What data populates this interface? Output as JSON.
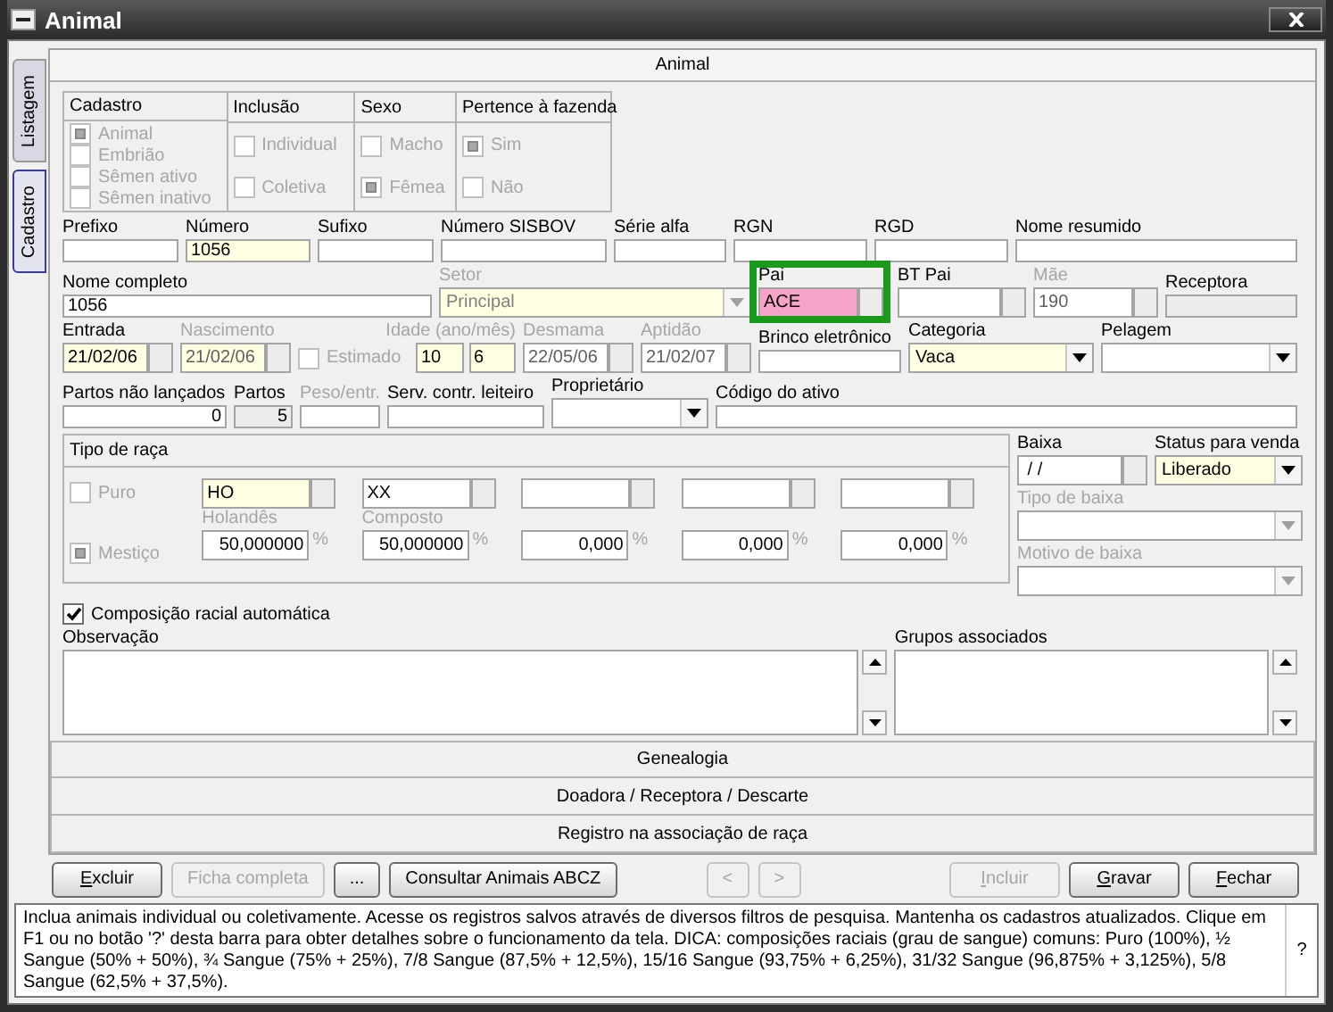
{
  "window": {
    "title": "Animal"
  },
  "side_tabs": [
    {
      "label": "Listagem",
      "selected": false
    },
    {
      "label": "Cadastro",
      "selected": true
    }
  ],
  "panel": {
    "title": "Animal"
  },
  "flags": {
    "disabled": true,
    "columns": [
      {
        "title": "Cadastro",
        "options": [
          {
            "label": "Animal",
            "checked": true
          },
          {
            "label": "Embrião",
            "checked": false
          },
          {
            "label": "Sêmen ativo",
            "checked": false
          },
          {
            "label": "Sêmen inativo",
            "checked": false
          }
        ]
      },
      {
        "title": "Inclusão",
        "options": [
          {
            "label": "Individual",
            "checked": false
          },
          {
            "label": "Coletiva",
            "checked": false
          }
        ]
      },
      {
        "title": "Sexo",
        "options": [
          {
            "label": "Macho",
            "checked": false
          },
          {
            "label": "Fêmea",
            "checked": true
          }
        ]
      },
      {
        "title": "Pertence à fazenda",
        "options": [
          {
            "label": "Sim",
            "checked": true
          },
          {
            "label": "Não",
            "checked": false
          }
        ]
      }
    ]
  },
  "field_rows": [
    [
      {
        "kind": "text",
        "label": "Prefixo",
        "color": "#ffffff",
        "disabled": false
      },
      {
        "kind": "text",
        "label": "Número",
        "value": "1056",
        "color": "#ffffe1",
        "disabled": false
      },
      {
        "kind": "text",
        "label": "Sufixo",
        "color": "#ffffff",
        "disabled": false
      },
      {
        "kind": "text",
        "label": "Número SISBOV",
        "color": "#ffffff",
        "disabled": false
      },
      {
        "kind": "text",
        "label": "Série alfa",
        "color": "#ffffff",
        "disabled": false
      },
      {
        "kind": "text",
        "label": "RGN",
        "color": "#ffffff",
        "disabled": false
      },
      {
        "kind": "text",
        "label": "RGD",
        "color": "#ffffff",
        "disabled": false
      },
      {
        "kind": "text",
        "label": "Nome resumido",
        "color": "#ffffff",
        "disabled": false
      }
    ],
    [
      {
        "kind": "text",
        "label": "Nome completo",
        "value": "1056",
        "color": "#ffffff",
        "disabled": false
      },
      {
        "kind": "dropdown",
        "label": "Setor",
        "value": "Principal",
        "color": "#ffffe1",
        "disabled": true
      },
      {
        "kind": "lookup",
        "label": "Pai",
        "value": "ACE",
        "color": "#f5a3c7",
        "disabled": false,
        "highlighted": true
      },
      {
        "kind": "lookup",
        "label": "BT Pai",
        "color": "#ffffff",
        "disabled": false,
        "highlighted": false
      },
      {
        "kind": "lookup",
        "label": "Mãe",
        "value": "190",
        "color": "#ffffff",
        "disabled": true,
        "highlighted": false
      },
      {
        "kind": "text",
        "label": "Receptora",
        "color": "#ececec",
        "disabled": false
      }
    ],
    [
      {
        "kind": "date",
        "label": "Entrada",
        "value": "21/02/06",
        "color": "#ffffe1",
        "disabled": false
      },
      {
        "kind": "date",
        "label": "Nascimento",
        "value": "21/02/06",
        "color": "#ffffe1",
        "disabled": true
      },
      {
        "kind": "check",
        "label": "Estimado",
        "checked": false,
        "disabled": true
      },
      {
        "kind": "pair",
        "label": "Idade (ano/mês)",
        "values": [
          "10",
          "6"
        ],
        "color": "#ffffe1",
        "disabled": true
      },
      {
        "kind": "date",
        "label": "Desmama",
        "value": "22/05/06",
        "color": "#ffffff",
        "disabled": true
      },
      {
        "kind": "date",
        "label": "Aptidão",
        "value": "21/02/07",
        "color": "#ffffff",
        "disabled": true
      },
      {
        "kind": "text",
        "label": "Brinco eletrônico",
        "color": "#ffffff",
        "disabled": false
      },
      {
        "kind": "dropdown",
        "label": "Categoria",
        "value": "Vaca",
        "color": "#ffffe1",
        "disabled": false
      },
      {
        "kind": "dropdown",
        "label": "Pelagem",
        "color": "#ffffff",
        "disabled": false
      }
    ],
    [
      {
        "kind": "number",
        "label": "Partos não lançados",
        "value": "0",
        "color": "#ffffff",
        "disabled": false
      },
      {
        "kind": "number",
        "label": "Partos",
        "value": "5",
        "color": "#ececec",
        "disabled": false
      },
      {
        "kind": "text",
        "label": "Peso/entr.",
        "color": "#ffffff",
        "disabled": true
      },
      {
        "kind": "text",
        "label": "Serv. contr. leiteiro",
        "color": "#ffffff",
        "disabled": false
      },
      {
        "kind": "dropdown",
        "label": "Proprietário",
        "color": "#ffffff",
        "disabled": false
      },
      {
        "kind": "text",
        "label": "Código do ativo",
        "color": "#ffffff",
        "disabled": false
      }
    ]
  ],
  "breed": {
    "title": "Tipo de raça",
    "disabled": true,
    "pure": {
      "label": "Puro",
      "checked": false
    },
    "mixed": {
      "label": "Mestiço",
      "checked": true
    },
    "breeds": [
      {
        "code": "HO",
        "color": "#ffffe1",
        "name": "Holandês",
        "percent": "50,000000",
        "unit": "%"
      },
      {
        "code": "XX",
        "color": "#ffffff",
        "name": "Composto",
        "percent": "50,000000",
        "unit": "%"
      },
      {
        "color": "#ffffff",
        "percent": "0,000",
        "unit": "%"
      },
      {
        "color": "#ffffff",
        "percent": "0,000",
        "unit": "%"
      },
      {
        "color": "#ffffff",
        "percent": "0,000",
        "unit": "%"
      }
    ]
  },
  "exit": [
    {
      "kind": "date",
      "label": "Baixa",
      "value": " / /",
      "color": "#ffffff",
      "disabled": false
    },
    {
      "kind": "dropdown",
      "label": "Status para venda",
      "value": "Liberado",
      "color": "#ffffe1",
      "disabled": false
    },
    {
      "kind": "dropdown",
      "label": "Tipo de baixa",
      "color": "#ffffff",
      "disabled": true
    },
    {
      "kind": "dropdown",
      "label": "Motivo de baixa",
      "color": "#ffffff",
      "disabled": true
    }
  ],
  "auto_composition": {
    "label": "Composição racial automática",
    "checked": true
  },
  "memos": [
    {
      "label": "Observação"
    },
    {
      "label": "Grupos associados"
    }
  ],
  "sections": [
    "Genealogia",
    "Doadora / Receptora / Descarte",
    "Registro na associação de raça"
  ],
  "buttons": {
    "left": [
      {
        "label": "Excluir",
        "disabled": false,
        "mnemonic": true
      },
      {
        "label": "Ficha completa",
        "disabled": true,
        "mnemonic": false
      },
      {
        "label": "...",
        "disabled": false
      },
      {
        "label": "Consultar Animais ABCZ",
        "disabled": false,
        "mnemonic": false
      }
    ],
    "nav": [
      {
        "label": "<",
        "disabled": true,
        "mnemonic": false
      },
      {
        "label": ">",
        "disabled": true,
        "mnemonic": false
      }
    ],
    "right": [
      {
        "label": "Incluir",
        "disabled": true,
        "mnemonic": true
      },
      {
        "label": "Gravar",
        "disabled": false,
        "mnemonic": true
      },
      {
        "label": "Fechar",
        "disabled": false,
        "mnemonic": true
      }
    ]
  },
  "help": {
    "text": "Inclua animais individual ou coletivamente. Acesse os registros salvos através de diversos filtros de pesquisa. Mantenha os cadastros atualizados. Clique em F1 ou no botão '?' desta barra para obter detalhes sobre o funcionamento da tela. DICA: composições raciais (grau de sangue) comuns: Puro (100%), ½ Sangue (50% + 50%), ¾ Sangue (75% + 25%), 7/8 Sangue (87,5% + 12,5%), 15/16 Sangue (93,75% + 6,25%), 31/32 Sangue (96,875% + 3,125%), 5/8 Sangue (62,5% + 37,5%).",
    "button": "?"
  }
}
